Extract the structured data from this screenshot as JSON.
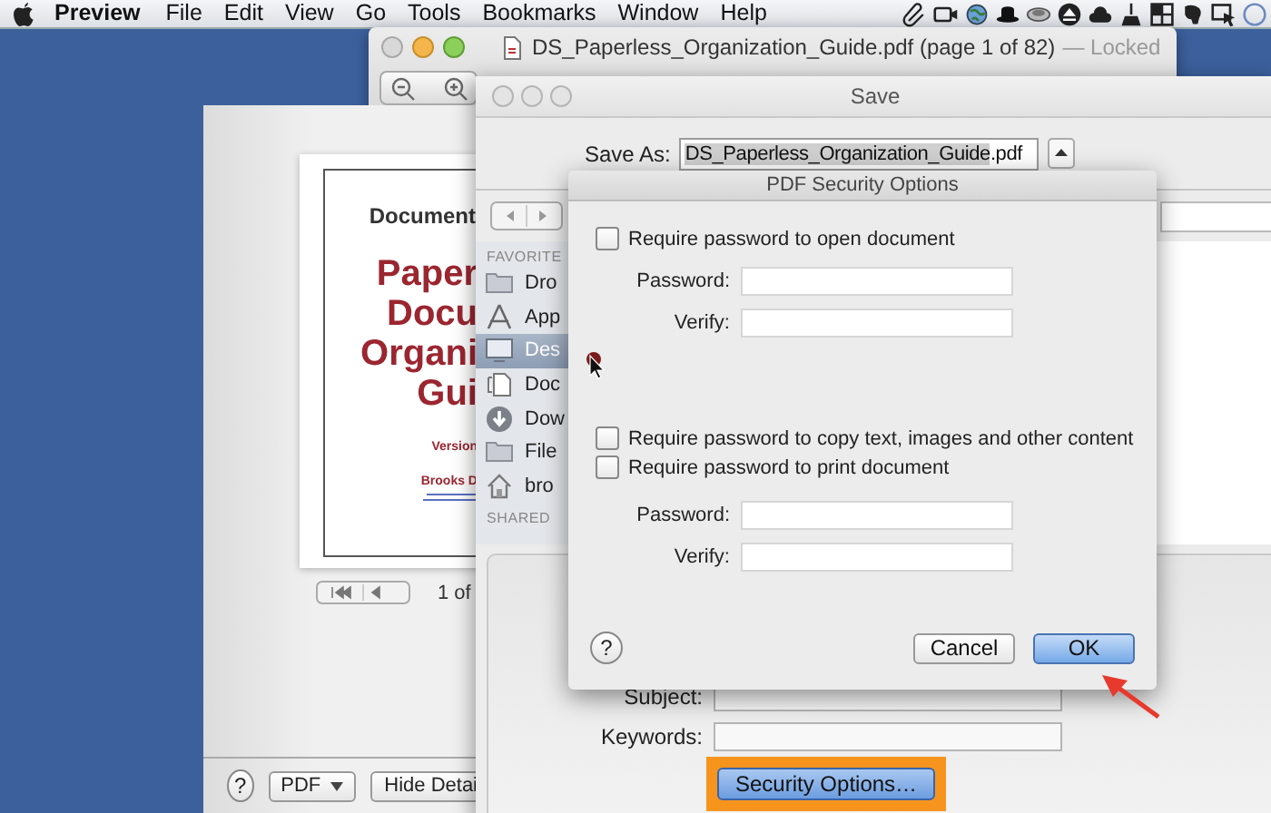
{
  "menu_bar": {
    "app_name": "Preview",
    "menus": [
      "File",
      "Edit",
      "View",
      "Go",
      "Tools",
      "Bookmarks",
      "Window",
      "Help"
    ]
  },
  "preview_window": {
    "title": "DS_Paperless_Organization_Guide.pdf (page 1 of 82)",
    "status": "— Locked"
  },
  "print_panel": {
    "page_lines": [
      {
        "text": "Document",
        "kind": "heading"
      },
      {
        "text": "Paper",
        "kind": "title"
      },
      {
        "text": "Docu",
        "kind": "title"
      },
      {
        "text": "Organi",
        "kind": "title"
      },
      {
        "text": "Gui",
        "kind": "title"
      },
      {
        "text": "Version",
        "kind": "note"
      },
      {
        "text": "Brooks D",
        "kind": "author"
      }
    ],
    "page_count": "1 of",
    "help": "?",
    "format_button": "PDF",
    "details_button": "Hide Detai"
  },
  "save_dialog": {
    "title": "Save",
    "save_as_label": "Save As:",
    "file_name": "DS_Paperless_Organization_Guide.pdf",
    "name_selected": true,
    "sidebar": {
      "favorites_heading": "FAVORITE",
      "items": [
        {
          "label": "Dro",
          "kind": "folder",
          "selected": false
        },
        {
          "label": "App",
          "kind": "apps",
          "selected": false
        },
        {
          "label": "Des",
          "kind": "desktop",
          "selected": true
        },
        {
          "label": "Doc",
          "kind": "documents",
          "selected": false
        },
        {
          "label": "Dow",
          "kind": "downloads",
          "selected": false
        },
        {
          "label": "File",
          "kind": "folder",
          "selected": false
        },
        {
          "label": "bro",
          "kind": "home",
          "selected": false
        }
      ],
      "shared_heading": "SHARED"
    },
    "fields": [
      {
        "label": "Subject:"
      },
      {
        "label": "Keywords:"
      }
    ],
    "security_button": {
      "label": "Security Options…",
      "highlighted": true
    }
  },
  "security_dialog": {
    "title": "PDF Security Options",
    "groups": [
      {
        "checkboxes": [
          {
            "label": "Require password to open document",
            "checked": false
          }
        ],
        "fields": [
          {
            "label": "Password:"
          },
          {
            "label": "Verify:"
          }
        ]
      },
      {
        "checkboxes": [
          {
            "label": "Require password to copy text, images and other content",
            "checked": false
          },
          {
            "label": "Require password to print document",
            "checked": false
          }
        ],
        "fields": [
          {
            "label": "Password:"
          },
          {
            "label": "Verify:"
          }
        ]
      }
    ],
    "help": "?",
    "buttons": [
      {
        "label": "Cancel",
        "default": false
      },
      {
        "label": "OK",
        "default": true
      }
    ]
  }
}
